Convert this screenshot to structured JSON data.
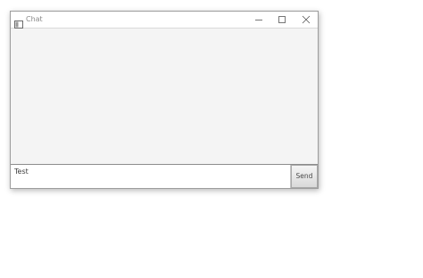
{
  "window": {
    "title": "Chat",
    "icon": "window-app-icon",
    "controls": [
      "minimize-icon",
      "maximize-icon",
      "close-icon"
    ]
  },
  "message_area": {
    "messages": []
  },
  "input": {
    "value": "Test"
  },
  "send_button": {
    "label": "Send"
  }
}
